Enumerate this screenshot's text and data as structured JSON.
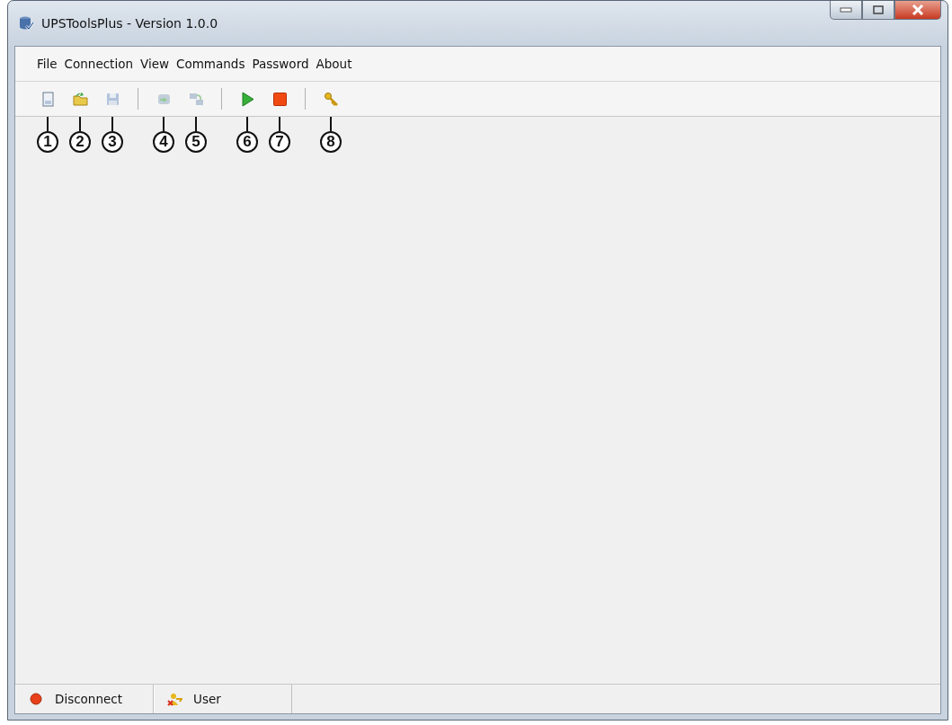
{
  "window": {
    "title": "UPSToolsPlus - Version 1.0.0"
  },
  "menu": [
    "File",
    "Connection",
    "View",
    "Commands",
    "Password",
    "About"
  ],
  "toolbar": [
    {
      "kind": "button",
      "disabled": false,
      "callout": "1"
    },
    {
      "kind": "button",
      "disabled": false,
      "callout": "2"
    },
    {
      "kind": "button",
      "disabled": true,
      "callout": "3"
    },
    {
      "kind": "separator"
    },
    {
      "kind": "button",
      "disabled": true,
      "callout": "4"
    },
    {
      "kind": "button",
      "disabled": true,
      "callout": "5"
    },
    {
      "kind": "separator"
    },
    {
      "kind": "button",
      "disabled": false,
      "callout": "6"
    },
    {
      "kind": "button",
      "disabled": false,
      "callout": "7"
    },
    {
      "kind": "separator"
    },
    {
      "kind": "button",
      "disabled": false,
      "callout": "8"
    }
  ],
  "status_bar": [
    {
      "text": "Disconnect"
    },
    {
      "text": "User"
    }
  ]
}
